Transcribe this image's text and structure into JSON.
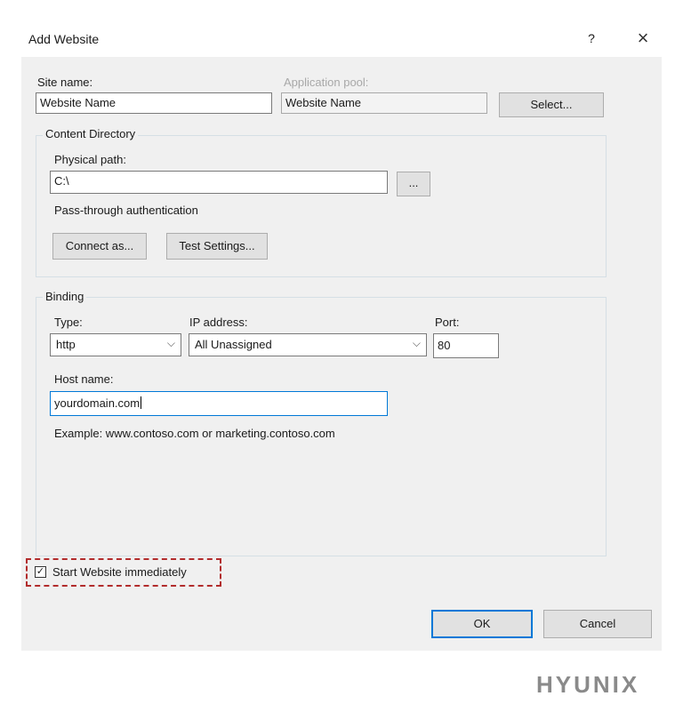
{
  "window": {
    "title": "Add Website",
    "help_label": "?",
    "close_label": "×"
  },
  "site": {
    "name_label": "Site name:",
    "name_value": "Website Name",
    "app_pool_label": "Application pool:",
    "app_pool_value": "Website Name",
    "select_button": "Select..."
  },
  "content_directory": {
    "caption": "Content Directory",
    "physical_path_label": "Physical path:",
    "physical_path_value": "C:\\",
    "browse_button": "...",
    "pass_through_label": "Pass-through authentication",
    "connect_as_button": "Connect as...",
    "test_settings_button": "Test Settings..."
  },
  "binding": {
    "caption": "Binding",
    "type_label": "Type:",
    "type_value": "http",
    "ip_label": "IP address:",
    "ip_value": "All Unassigned",
    "port_label": "Port:",
    "port_value": "80",
    "host_label": "Host name:",
    "host_value": "yourdomain.com",
    "example_text": "Example: www.contoso.com or marketing.contoso.com"
  },
  "start_immediately": {
    "label": "Start Website immediately",
    "checked": true,
    "check_glyph": "✓"
  },
  "footer": {
    "ok_button": "OK",
    "cancel_button": "Cancel"
  },
  "brand": "HYUNIX",
  "icons": {
    "dropdown": "chevron-down-icon",
    "check": "check-icon",
    "close": "close-icon"
  },
  "colors": {
    "focus_border": "#0078d7",
    "highlight_dash": "#b22c2c",
    "dialog_bg": "#f0f0f0"
  }
}
